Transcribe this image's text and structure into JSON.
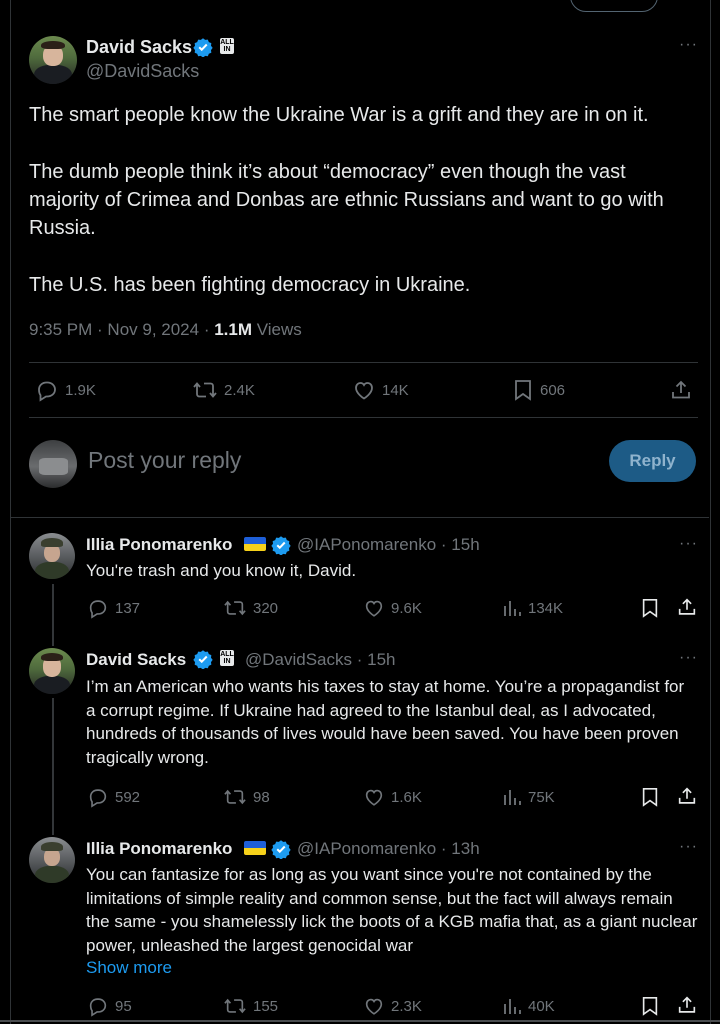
{
  "main_tweet": {
    "author_name": "David Sacks",
    "author_handle": "@DavidSacks",
    "paragraphs": [
      "The smart people know the Ukraine War is a grift and they are in on it.",
      "The dumb people think it’s about “democracy” even though the vast majority of Crimea and Donbas are ethnic Russians and want to go with Russia.",
      "The U.S. has been fighting democracy in Ukraine."
    ],
    "time": "9:35 PM",
    "date": "Nov 9, 2024",
    "views_count": "1.1M",
    "views_label": "Views",
    "replies": "1.9K",
    "reposts": "2.4K",
    "likes": "14K",
    "bookmarks": "606"
  },
  "compose": {
    "placeholder": "Post your reply",
    "button": "Reply"
  },
  "replies": [
    {
      "author_name": "Illia Ponomarenko",
      "author_handle": "@IAPonomarenko",
      "time": "· 15h",
      "text": "You're trash and you know it, David.",
      "replies": "137",
      "reposts": "320",
      "likes": "9.6K",
      "views": "134K"
    },
    {
      "author_name": "David Sacks",
      "author_handle": "@DavidSacks",
      "time": "· 15h",
      "text": "I’m an American who wants his taxes to stay at home. You’re a propagandist for a corrupt regime. If Ukraine had agreed to the Istanbul deal, as I advocated, hundreds of thousands of lives would have been saved. You have been proven tragically wrong.",
      "replies": "592",
      "reposts": "98",
      "likes": "1.6K",
      "views": "75K"
    },
    {
      "author_name": "Illia Ponomarenko",
      "author_handle": "@IAPonomarenko",
      "time": "· 13h",
      "text": "You can fantasize for as long as you want since you're not contained by the limitations of simple reality and common sense, but the fact will always remain the same - you shamelessly lick the boots of a KGB mafia that, as a giant nuclear power, unleashed the largest genocidal war",
      "show_more": "Show more",
      "replies": "95",
      "reposts": "155",
      "likes": "2.3K",
      "views": "40K"
    }
  ],
  "all_in_badge": "ALL IN",
  "colors": {
    "background": "#000000",
    "text": "#e7e9ea",
    "muted": "#71767b",
    "accent": "#1d9bf0",
    "divider": "#2f3336",
    "reply_button": "#1d5b86"
  },
  "icons": [
    "verified-badge-icon",
    "all-in-badge-icon",
    "ukraine-flag-icon",
    "more-icon",
    "reply-icon",
    "repost-icon",
    "like-icon",
    "bookmark-icon",
    "share-icon",
    "views-icon"
  ]
}
